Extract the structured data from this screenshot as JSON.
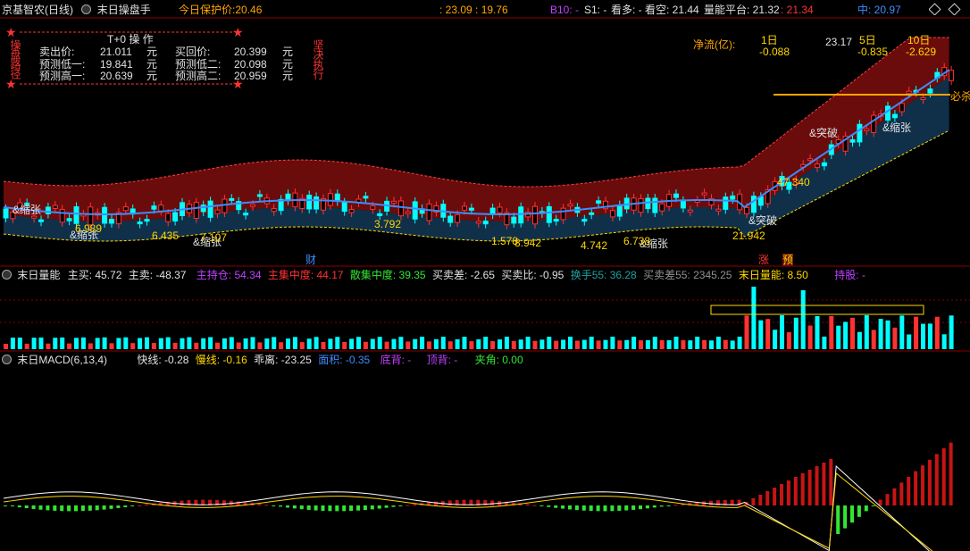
{
  "title": {
    "app": "京基智农(日线)",
    "indicator": "末日操盘手",
    "protect_label": "今日保护价:",
    "protect_value": "20.46",
    "time_range": ": 23.09 : 19.76",
    "b10": "B10: -",
    "s1": "S1: -",
    "look_up": "看多: -",
    "look_down": "看空: 21.44",
    "energy_platform": "量能平台: 21.32",
    "energy_value": ": 21.34",
    "mid": "中: 20.97"
  },
  "t0": {
    "title": "T+0 操 作",
    "sell_label": "卖出价:",
    "sell_value": "21.011",
    "buyback_label": "买回价:",
    "buyback_value": "20.399",
    "pred_low1_label": "预测低一:",
    "pred_low1": "19.841",
    "pred_low2_label": "预测低二:",
    "pred_low2": "20.098",
    "pred_high1_label": "预测高一:",
    "pred_high1": "20.639",
    "pred_high2_label": "预测高二:",
    "pred_high2": "20.959",
    "unit": "元",
    "side_left": "操盘路径",
    "side_right": "坚决执行"
  },
  "flow": {
    "label": "净流(亿):",
    "d1_label": "1日",
    "d1_value": "-0.088",
    "d5_label": "5日",
    "d5_value": "-0.835",
    "d10_label": "10日",
    "d10_value": "-2.629"
  },
  "main_annotations": [
    "&缩张",
    "&突破",
    "&突破",
    "&缩张",
    "&缩张",
    "&缩张",
    "&缩张",
    "必杀",
    "财",
    "涨",
    "预"
  ],
  "price_labels": [
    "3.792",
    "1.578",
    "8.942",
    "4.742",
    "6.738",
    "21.942",
    "47.340",
    "6.989",
    "6.435",
    "7.107",
    "23.17"
  ],
  "volume": {
    "name": "末日量能",
    "main_buy": "主买: 45.72",
    "main_sell": "主卖: -48.37",
    "main_hold": "主持仓: 54.34",
    "main_conc": "主集中度: 44.17",
    "retail_conc": "散集中度: 39.35",
    "bs_diff": "买卖差: -2.65",
    "bs_ratio": "买卖比: -0.95",
    "turnover": "换手55: 36.28",
    "bs_diff55": "买卖差55: 2345.25",
    "energy": "末日量能: 8.50",
    "hold": "持股: -"
  },
  "macd": {
    "name": "末日MACD(6,13,4)",
    "fast": "快线: -0.28",
    "slow": "慢线: -0.16",
    "dev": "乖离: -23.25",
    "area": "面积: -0.35",
    "bottom_div": "底背: -",
    "top_div": "顶背: -",
    "angle": "夹角: 0.00"
  },
  "colors": {
    "up": "#ff3232",
    "down": "#00ffff",
    "band": "#6b0c0c",
    "band_low": "#10304a",
    "macd_up": "#c81414",
    "macd_down": "#32e632"
  },
  "icons": [
    "circle-menu-icon",
    "minimize-icon",
    "maximize-icon",
    "star-icon",
    "arrow-up-icon"
  ]
}
